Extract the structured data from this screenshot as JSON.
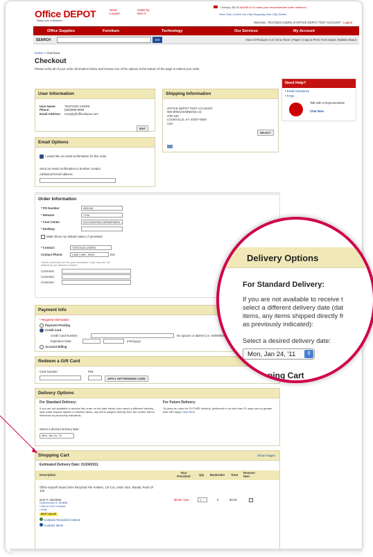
{
  "header": {
    "logo": "Office DEPOT",
    "tagline": "Taking Care of Business",
    "store_locator": "Store Locator",
    "order_by_item": "Order by Item #",
    "cart_summary": "1 item(s): $3.00",
    "cart_promo": "Add $5.01 to meet your recommended order minimum",
    "cart_links": "View Cart | Check Out | My Shopping Lists | My Orders",
    "welcome": "Welcome, TEST2020 USERS of OFFICE DEPOT TEST ACCOUNT",
    "logout": "Logout"
  },
  "nav": [
    "Office Supplies",
    "Furniture",
    "Technology",
    "Our Services",
    "My Account"
  ],
  "search": {
    "label": "SEARCH",
    "go": "GO",
    "links": "View All Products A-Z  |  Ink & Toner  |  Paper  |  Copy & Print  |  Tech Depot  |  Bulletin Board"
  },
  "breadcrumb": {
    "home": "Home",
    "sep": " > ",
    "current": "Checkout"
  },
  "page": {
    "title": "Checkout",
    "intro": "Please verify all of your order information below and choose one of the options at the bottom of the page to submit your order."
  },
  "help": {
    "title": "Need Help?",
    "email": "• Email Assistance",
    "faqs": "• FAQs",
    "talk": "Talk with a Representative",
    "chat": "Chat Now"
  },
  "user_info": {
    "title": "User Information",
    "labels": [
      "User Name:",
      "Phone:",
      "Email Address:"
    ],
    "values": [
      "TEST2020 USERS",
      "(800)999-9999",
      "noreply@officedepot.com"
    ],
    "edit": "EDIT"
  },
  "shipping": {
    "title": "Shipping Information",
    "lines": [
      "OFFICE DEPOT TEST ACCOUNT",
      "900 BRECKENRIDGE LN",
      "STE 220",
      "LOUISVILLE, KY  40207-5929",
      "USA"
    ],
    "select": "SELECT"
  },
  "email_options": {
    "title": "Email Options",
    "checkbox": "I would like an email confirmation for this order",
    "send_other": "Send an email confirmation to another contact:",
    "additional": "Additional Email Address:"
  },
  "order_info": {
    "title": "Order Information",
    "fields": [
      {
        "label": "PO Number",
        "value": "AR1234"
      },
      {
        "label": "Release",
        "value": "7734"
      },
      {
        "label": "Cost Center",
        "value": "ACCOUNTING DEPARTMEN"
      },
      {
        "label": "Desktop",
        "value": ""
      }
    ],
    "defaults": "Make these my default values, if permitted",
    "contact_label": "Contact:",
    "contact_value": "TEST2020 USERS",
    "phone_label": "Contact Phone:",
    "phone_value": "( 800 ) 999 - 9999",
    "ext": "Ext.",
    "note": "These comments are for your information only; they are not utilized by our Delivery Centers.",
    "comment": "Comment:"
  },
  "payment": {
    "title": "Payment Info",
    "required": "* Required information",
    "pending": "Payment Pending",
    "credit": "Credit Card",
    "cc_label": "Credit Card Number:",
    "cc_hint": "No spaces or dashes (i.e. 0000000000000)",
    "exp_label": "Expiration Date:",
    "exp_fmt": "(mm/yyyy)",
    "billing": "Account Billing"
  },
  "gift": {
    "title": "Redeem a Gift Card",
    "card": "Card Number:",
    "pin": "PIN:",
    "apply": "APPLY GIFT/REWARD CARD"
  },
  "delivery": {
    "title": "Delivery Options",
    "standard": "For Standard Delivery:",
    "future": "For Future Delivery:",
    "standard_text": "If you are not available to receive this order on the date below, then select a different delivery date (date request applies to stocked items, any items shipped directly from the vendor will be delivered as previously indicated):",
    "future_text": "To place an order for FUTURE delivery, (delivered in no less than 21 days and no greater than 180 days)",
    "click_here": "Click Here",
    "select_label": "Select a desired delivery date:",
    "date": "Mon, Jan 24, '11"
  },
  "magnifier": {
    "title": "Delivery Options",
    "standard": "For Standard Delivery:",
    "line1": "If you are not available to receive t",
    "line2": "select a different delivery date (dat",
    "line3": "items, any items shipped directly fr",
    "line4": "as previously indicated):",
    "select_label": "Select a desired delivery date:",
    "date": "Mon, Jan 24, '11",
    "cart": "Shopping Cart"
  },
  "cart": {
    "title": "Shopping Cart",
    "show_images": "Show Images",
    "estimated": "Estimated Delivery Date: 01/24/2011",
    "columns": [
      "Description",
      "Your Price/unit",
      "Qty.",
      "Backorder",
      "Total",
      "Remove Item"
    ],
    "item_name": "Office Depot® Brand 30% Recycled File Folders, 1/3 Cut, Letter Size, Manila, Pack Of 100",
    "item_num": "Item #: 0810838",
    "ordered": "Ordered Item #: 810838",
    "not_on_csl": "• Not on CSL Contract",
    "hub": "• HUB",
    "best_value": "BEST VALUE",
    "recycled": "Contains Recycled Content",
    "contract": "Contract Items",
    "price": "$3.00 / box",
    "qty": "1",
    "backorder": "0",
    "total": "$3.00"
  },
  "colors": {
    "brand": "#cc0000",
    "accent": "#d0004a",
    "panel": "#f1e8b8"
  }
}
